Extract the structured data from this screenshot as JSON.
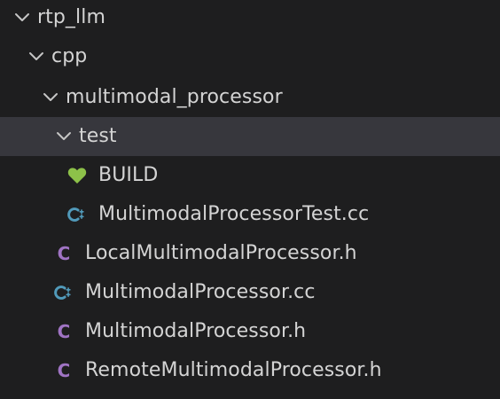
{
  "explorer": {
    "root": {
      "label": "rtp_llm",
      "expanded": true
    },
    "cpp": {
      "label": "cpp",
      "expanded": true
    },
    "multimodal_processor": {
      "label": "multimodal_processor",
      "expanded": true
    },
    "test": {
      "label": "test",
      "expanded": true,
      "selected": true
    },
    "files": [
      {
        "label": "BUILD",
        "icon": "bazel-heart-icon"
      },
      {
        "label": "MultimodalProcessorTest.cc",
        "icon": "cpp-icon"
      },
      {
        "label": "LocalMultimodalProcessor.h",
        "icon": "c-header-icon",
        "icon_letter": "C"
      },
      {
        "label": "MultimodalProcessor.cc",
        "icon": "cpp-icon"
      },
      {
        "label": "MultimodalProcessor.h",
        "icon": "c-header-icon",
        "icon_letter": "C"
      },
      {
        "label": "RemoteMultimodalProcessor.h",
        "icon": "c-header-icon",
        "icon_letter": "C"
      }
    ]
  },
  "colors": {
    "background": "#1e1e1f",
    "selected_row": "#37373d",
    "text": "#d4d4d4",
    "chevron": "#c5c5c5",
    "bazel_green": "#8dc149",
    "cpp_blue": "#519aba",
    "c_header_purple": "#a074c4"
  }
}
